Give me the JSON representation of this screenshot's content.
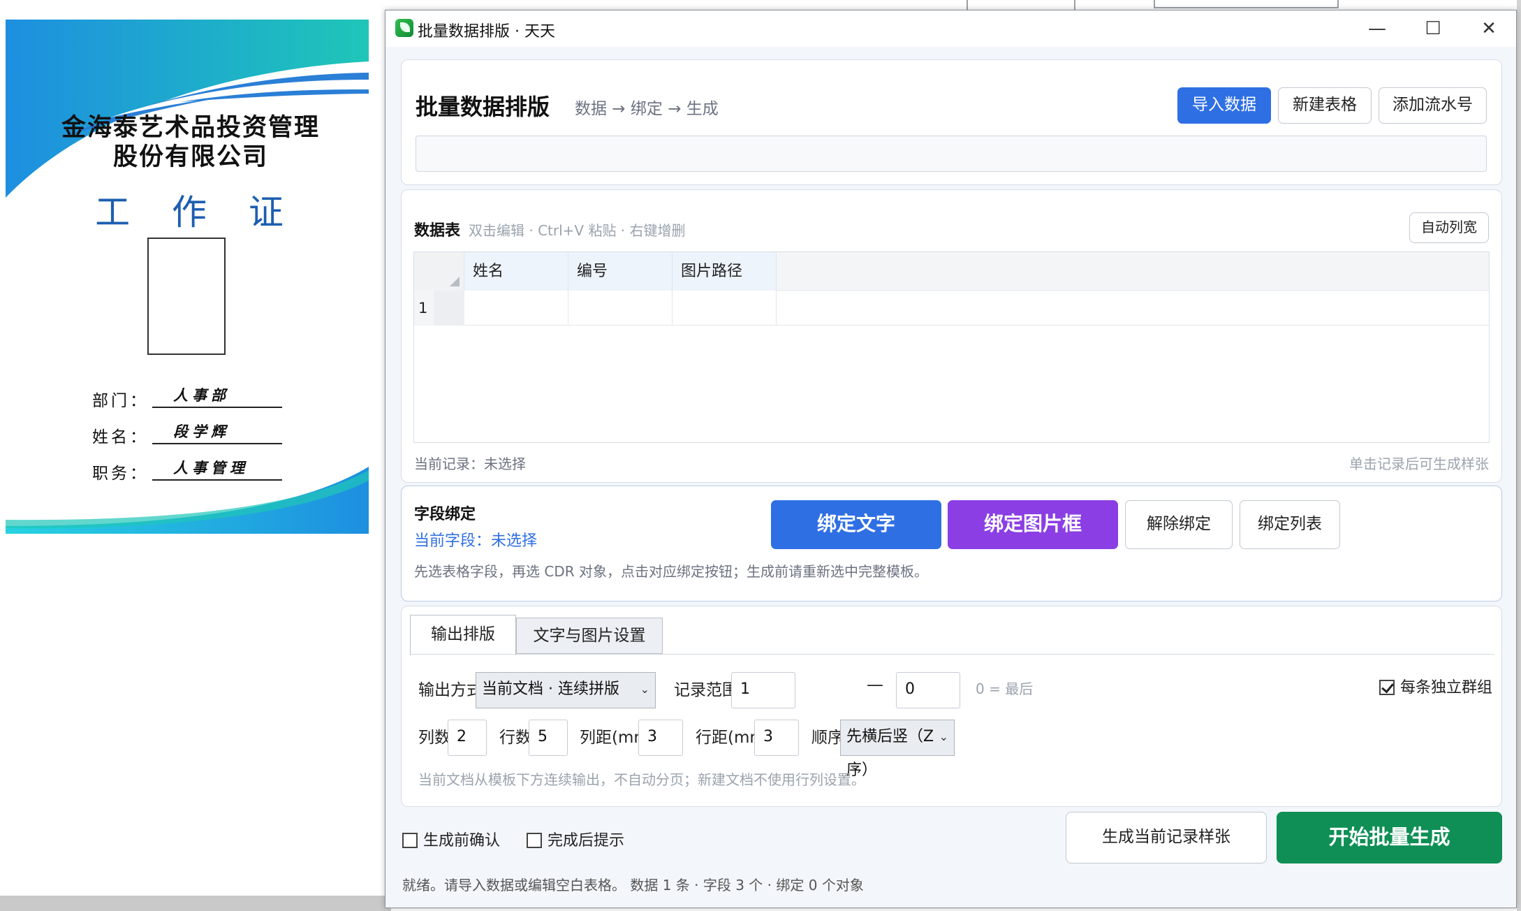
{
  "card": {
    "company_line1": "金海泰艺术品投资管理",
    "company_line2": "股份有限公司",
    "title": "工 作 证",
    "fields": [
      {
        "label": "部门：",
        "value": "人事部"
      },
      {
        "label": "姓名：",
        "value": "段学辉"
      },
      {
        "label": "职务：",
        "value": "人事管理"
      }
    ],
    "colors": {
      "accent_blue": "#1d8fe0",
      "accent_cyan": "#1fc6b8",
      "title_blue": "#1d5fb0"
    }
  },
  "window": {
    "title": "批量数据排版 · 天天",
    "controls": {
      "minimize": "—",
      "maximize": "☐",
      "close": "✕"
    }
  },
  "header": {
    "heading": "批量数据排版",
    "subtitle": "数据 → 绑定 → 生成",
    "buttons": {
      "import": "导入数据",
      "new_table": "新建表格",
      "add_serial": "添加流水号"
    },
    "path_value": ""
  },
  "table": {
    "title": "数据表",
    "hint": "双击编辑 · Ctrl+V 粘贴 · 右键增删",
    "auto_width_label": "自动列宽",
    "columns": [
      "姓名",
      "编号",
      "图片路径"
    ],
    "rows": [
      {
        "index": "1",
        "cells": [
          "",
          "",
          ""
        ]
      }
    ],
    "current_record": "当前记录：未选择",
    "footer_hint": "单击记录后可生成样张"
  },
  "binding": {
    "title": "字段绑定",
    "current_field": "当前字段：未选择",
    "hint": "先选表格字段，再选 CDR 对象，点击对应绑定按钮；生成前请重新选中完整模板。",
    "buttons": {
      "bind_text": "绑定文字",
      "bind_image": "绑定图片框",
      "unbind": "解除绑定",
      "bind_list": "绑定列表"
    }
  },
  "output": {
    "tabs": [
      "输出排版",
      "文字与图片设置"
    ],
    "output_mode_label": "输出方式",
    "output_mode_value": "当前文档 · 连续拼版",
    "range_label": "记录范围",
    "range_start": "1",
    "range_dash": "—",
    "range_end": "0",
    "range_note": "0 = 最后",
    "group_label": "每条独立群组",
    "group_checked": true,
    "cols_label": "列数",
    "cols_value": "2",
    "rows_label": "行数",
    "rows_value": "5",
    "colgap_label": "列距(mm)",
    "colgap_value": "3",
    "rowgap_label": "行距(mm)",
    "rowgap_value": "3",
    "order_label": "顺序",
    "order_value": "先横后竖（Z序）",
    "hint": "当前文档从模板下方连续输出，不自动分页；新建文档不使用行列设置。"
  },
  "footer": {
    "confirm_label": "生成前确认",
    "notify_label": "完成后提示",
    "sample_button": "生成当前记录样张",
    "start_button": "开始批量生成",
    "status": "就绪。请导入数据或编辑空白表格。  数据 1 条 · 字段 3 个 · 绑定 0 个对象"
  }
}
